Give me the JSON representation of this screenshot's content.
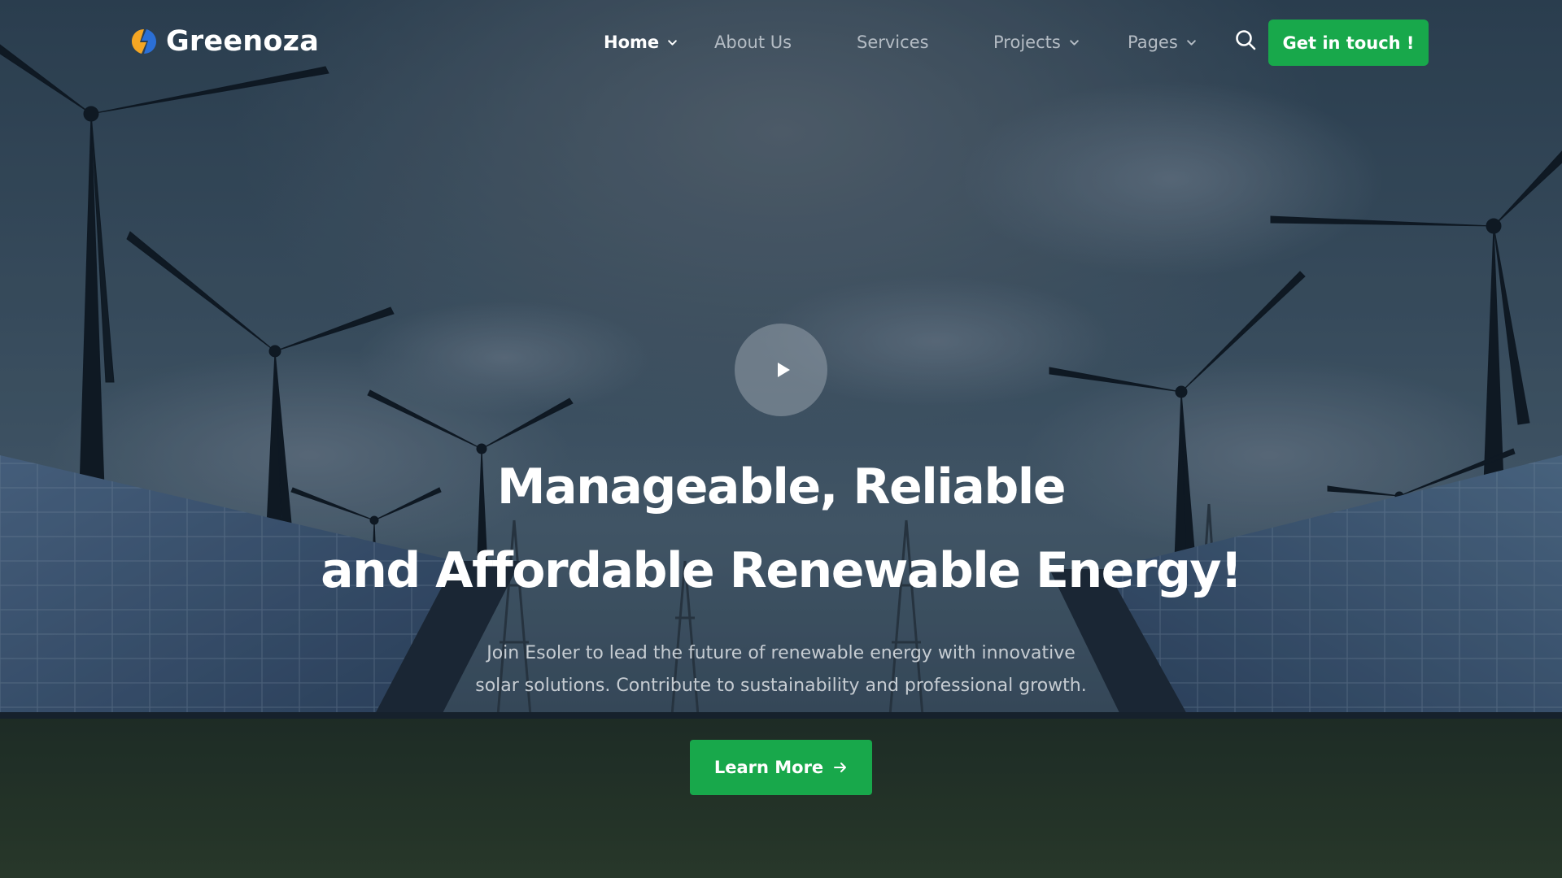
{
  "brand": {
    "name": "Greenoza",
    "logo_icon": "bolt-leaf-icon"
  },
  "nav": {
    "items": [
      {
        "label": "Home",
        "active": true,
        "has_dropdown": true
      },
      {
        "label": "About Us",
        "active": false,
        "has_dropdown": false
      },
      {
        "label": "Services",
        "active": false,
        "has_dropdown": false
      },
      {
        "label": "Projects",
        "active": false,
        "has_dropdown": true
      },
      {
        "label": "Pages",
        "active": false,
        "has_dropdown": true
      }
    ],
    "search_icon": "search-icon",
    "cta_label": "Get in touch !"
  },
  "hero": {
    "background": "wind turbines and solar panels over grass field",
    "play_icon": "play-icon",
    "title_line1": "Manageable, Reliable",
    "title_line2": "and Affordable Renewable Energy!",
    "desc_line1": "Join Esoler to lead the future of renewable energy with innovative",
    "desc_line2": "solar solutions. Contribute to sustainability and professional growth.",
    "button_label": "Learn More",
    "button_icon": "arrow-right-icon"
  },
  "colors": {
    "accent_green": "#18a84b",
    "nav_text": "#b4bcc4",
    "nav_active": "#ffffff",
    "logo_blue": "#2b6fd6",
    "logo_orange": "#f5a623"
  }
}
